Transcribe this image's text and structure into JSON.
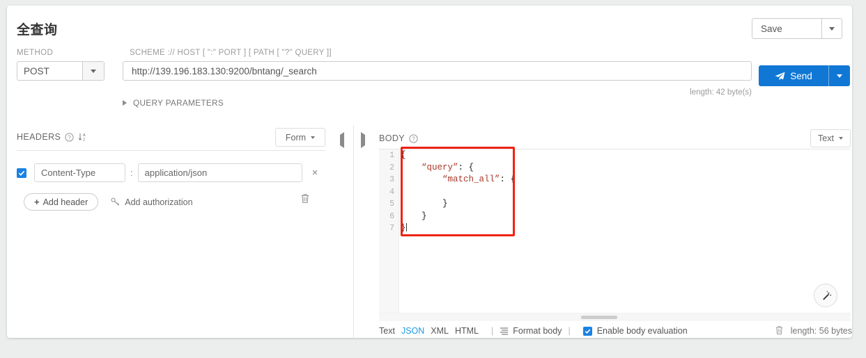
{
  "header": {
    "title": "全查询",
    "method_label": "METHOD",
    "scheme_label": "SCHEME :// HOST [ \":\" PORT ] [ PATH [ \"?\" QUERY ]]",
    "method_value": "POST",
    "url_value": "http://139.196.183.130:9200/bntang/_search",
    "url_length": "length: 42 byte(s)",
    "query_parameters_label": "QUERY PARAMETERS",
    "save_label": "Save",
    "send_label": "Send"
  },
  "headers_panel": {
    "title": "HEADERS",
    "mode_label": "Form",
    "rows": [
      {
        "enabled": true,
        "key": "Content-Type",
        "separator": ":",
        "value": "application/json",
        "remove_label": "×"
      }
    ],
    "add_header_label": "Add header",
    "add_header_plus": "+",
    "add_authorization_label": "Add authorization"
  },
  "body_panel": {
    "title": "BODY",
    "mode_label": "Text",
    "line_numbers": [
      "1",
      "2",
      "3",
      "4",
      "5",
      "6",
      "7"
    ],
    "code_lines": [
      {
        "indent": 0,
        "segments": [
          {
            "t": "{",
            "c": "p"
          }
        ]
      },
      {
        "indent": 4,
        "segments": [
          {
            "t": "“query”",
            "c": "k"
          },
          {
            "t": ": {",
            "c": "p"
          }
        ]
      },
      {
        "indent": 8,
        "segments": [
          {
            "t": "“match_all”",
            "c": "k"
          },
          {
            "t": ": {",
            "c": "p"
          }
        ]
      },
      {
        "indent": 0,
        "segments": []
      },
      {
        "indent": 8,
        "segments": [
          {
            "t": "}",
            "c": "p"
          }
        ]
      },
      {
        "indent": 4,
        "segments": [
          {
            "t": "}",
            "c": "p"
          }
        ]
      },
      {
        "indent": 0,
        "segments": [
          {
            "t": "}",
            "c": "p"
          }
        ]
      }
    ],
    "formats": [
      {
        "label": "Text",
        "active": false
      },
      {
        "label": "JSON",
        "active": true
      },
      {
        "label": "XML",
        "active": false
      },
      {
        "label": "HTML",
        "active": false
      }
    ],
    "format_body_label": "Format body",
    "enable_eval_label": "Enable body evaluation",
    "enable_eval_checked": true,
    "body_length": "length: 56 bytes"
  },
  "colors": {
    "accent_blue": "#1077d4",
    "link_blue": "#1a9ae4",
    "annotation_red": "#ee2211",
    "json_key_red": "#a8392b"
  }
}
